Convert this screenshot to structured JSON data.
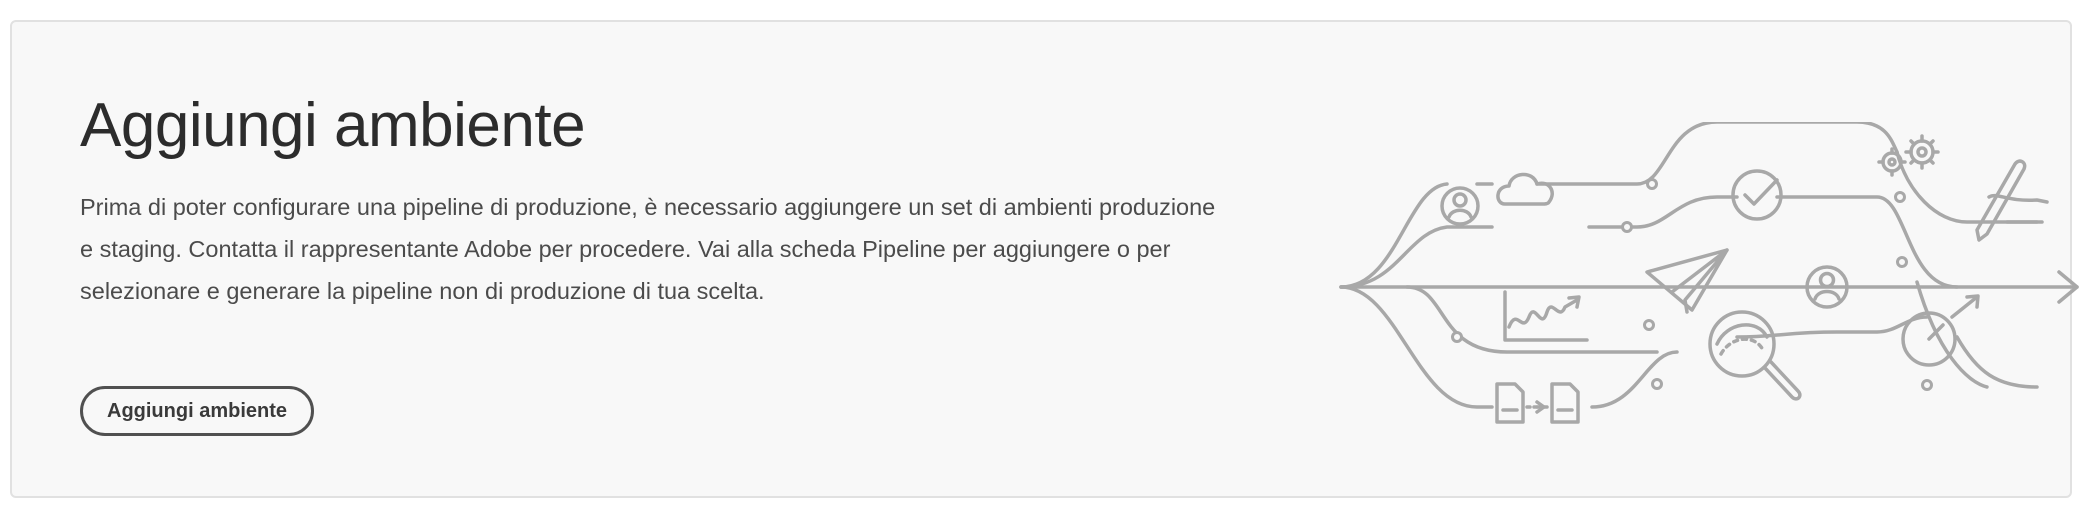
{
  "card": {
    "title": "Aggiungi ambiente",
    "description": "Prima di poter configurare una pipeline di produzione, è necessario aggiungere un set di ambienti produzione e staging. Contatta il rappresentante Adobe per procedere. Vai alla scheda Pipeline per aggiungere o per selezionare e generare la pipeline non di produzione di tua scelta.",
    "button_label": "Aggiungi ambiente"
  },
  "illustration": {
    "icons": [
      "user-icon",
      "cloud-icon",
      "check-icon",
      "gears-icon",
      "pen-icon",
      "chart-icon",
      "paper-plane-icon",
      "user-icon",
      "magnifier-icon",
      "gauge-icon",
      "document-icon",
      "document-icon"
    ],
    "stroke_color": "#a8a8a8"
  },
  "colors": {
    "card_background": "#f8f8f8",
    "card_border": "#e1e1e1",
    "title_text": "#2c2c2c",
    "body_text": "#4b4b4b",
    "button_border": "#505050"
  }
}
